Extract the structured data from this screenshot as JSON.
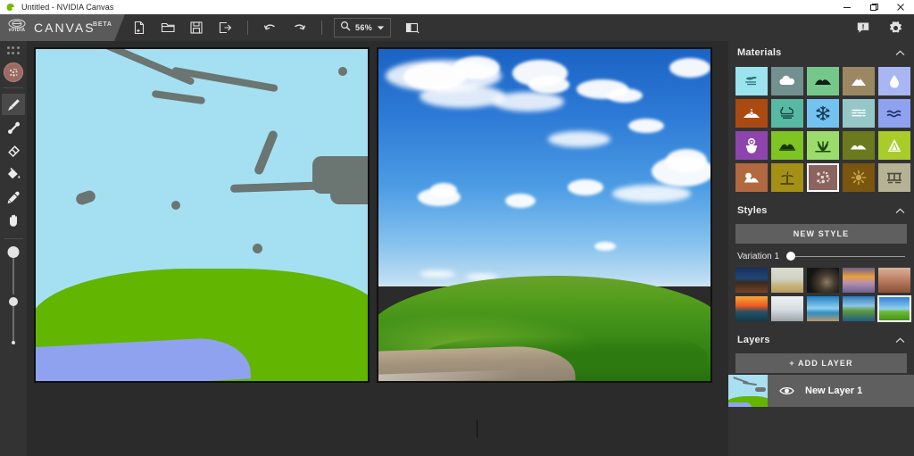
{
  "window": {
    "title": "Untitled - NVIDIA Canvas",
    "app_icon": "nvidia-app-icon",
    "minimize": "─",
    "maximize": "❐",
    "close": "✕"
  },
  "brand": {
    "logo": "nvidia-logo",
    "logo_wordmark": "nVIDIA",
    "name": "CANVAS",
    "beta": "BETA"
  },
  "toolbar": {
    "new_label": "new-document",
    "open_label": "open-project",
    "save_label": "save-project",
    "export_label": "export-image",
    "undo_label": "undo",
    "redo_label": "redo",
    "zoom_value": "56%",
    "zoom_icon": "magnifier-icon",
    "zoom_dropdown": "▼",
    "view_mode_label": "split-view-toggle",
    "feedback_label": "feedback-icon",
    "settings_label": "settings-gear-icon"
  },
  "tools": {
    "grip": "panel-drag-grip",
    "current_material_swatch_color": "#9c6a63",
    "items": [
      {
        "name": "paintbrush-tool",
        "label": "Paint Brush",
        "active": true
      },
      {
        "name": "line-tool",
        "label": "Line",
        "active": false
      },
      {
        "name": "eraser-tool",
        "label": "Eraser",
        "active": false
      },
      {
        "name": "fill-tool",
        "label": "Fill",
        "active": false
      },
      {
        "name": "eyedropper-tool",
        "label": "Eyedropper",
        "active": false
      },
      {
        "name": "hand-tool",
        "label": "Pan",
        "active": false
      }
    ],
    "brush_size_slider": {
      "name": "brush-size-slider",
      "knob_position_pct": 0
    },
    "brush_opacity_slider": {
      "name": "brush-opacity-slider",
      "knob_position_pct": 62
    }
  },
  "canvas": {
    "sketch_pane_name": "sketch-canvas",
    "render_pane_name": "rendered-output",
    "sketch": {
      "sky_color": "#a5e0f2",
      "grass_color": "#62b500",
      "water_color": "#8ea2f0",
      "stroke_color": "#6b7571"
    },
    "render": {
      "sky_top_color": "#1b63c4",
      "sky_bottom_color": "#cfe6f2",
      "grass_color": "#3f8f18",
      "water_color": "#a2937c",
      "cloud_color": "#ffffff"
    }
  },
  "materials": {
    "title": "Materials",
    "collapse_icon": "chevron-up-icon",
    "selected_index": 17,
    "items": [
      {
        "label": "Sky",
        "icon": "sky-icon",
        "bg": "#9be4ef",
        "fg": "#2f6f74"
      },
      {
        "label": "Cloud",
        "icon": "cloud-icon",
        "bg": "#71908f",
        "fg": "#ffffff"
      },
      {
        "label": "Hill",
        "icon": "hill-icon",
        "bg": "#74c98a",
        "fg": "#111d12"
      },
      {
        "label": "Mountain",
        "icon": "mountain-icon",
        "bg": "#9c8763",
        "fg": "#ffffff"
      },
      {
        "label": "Water",
        "icon": "waterdrop-icon",
        "bg": "#a8b7f4",
        "fg": "#ffffff"
      },
      {
        "label": "Mud",
        "icon": "mud-icon",
        "bg": "#ab4a10",
        "fg": "#ffffff"
      },
      {
        "label": "Fog",
        "icon": "fog-icon",
        "bg": "#57b8a4",
        "fg": "#123d36"
      },
      {
        "label": "Snow",
        "icon": "snowflake-icon",
        "bg": "#72c3f2",
        "fg": "#13344a"
      },
      {
        "label": "Sand",
        "icon": "sand-icon",
        "bg": "#95c7c9",
        "fg": "#ffffff"
      },
      {
        "label": "Sea",
        "icon": "sea-icon",
        "bg": "#8ea2f0",
        "fg": "#1c2c6b"
      },
      {
        "label": "Flowers",
        "icon": "flower-icon",
        "bg": "#8e44ad",
        "fg": "#ffffff"
      },
      {
        "label": "Bush",
        "icon": "bush-icon",
        "bg": "#7ec422",
        "fg": "#16330a"
      },
      {
        "label": "Grass",
        "icon": "grass-icon",
        "bg": "#9bdc6c",
        "fg": "#1b4709"
      },
      {
        "label": "Hill2",
        "icon": "hills-icon",
        "bg": "#6b7a1e",
        "fg": "#ffffff"
      },
      {
        "label": "Tree",
        "icon": "tree-icon",
        "bg": "#a9cc2a",
        "fg": "#ffffff"
      },
      {
        "label": "Rock",
        "icon": "rock-icon",
        "bg": "#b2693f",
        "fg": "#ffffff"
      },
      {
        "label": "Desert",
        "icon": "palm-icon",
        "bg": "#a59016",
        "fg": "#3a3208"
      },
      {
        "label": "Gravel",
        "icon": "gravel-icon",
        "bg": "#8b6460",
        "fg": "#e6d7d4"
      },
      {
        "label": "Dirt",
        "icon": "dirt-icon",
        "bg": "#7a5510",
        "fg": "#c8a64a"
      },
      {
        "label": "Ruins",
        "icon": "ruins-icon",
        "bg": "#b5b296",
        "fg": "#4a4736"
      }
    ]
  },
  "styles": {
    "title": "Styles",
    "collapse_icon": "chevron-up-icon",
    "new_style_label": "NEW STYLE",
    "variation_label": "Variation 1",
    "variation_value_pct": 0,
    "selected_index": 9,
    "items": [
      {
        "name": "style-thumb-1",
        "c1": "#1e3a66",
        "c2": "#0b1524",
        "c3": "#7a4124"
      },
      {
        "name": "style-thumb-2",
        "c1": "#cfd2c4",
        "c2": "#e3e1d2",
        "c3": "#bda96f"
      },
      {
        "name": "style-thumb-3",
        "c1": "#121212",
        "c2": "#2b2b2b",
        "c3": "#7e6d58"
      },
      {
        "name": "style-thumb-4",
        "c1": "#8a6fa3",
        "c2": "#e9a13b",
        "c3": "#6d5f8f"
      },
      {
        "name": "style-thumb-5",
        "c1": "#c2876c",
        "c2": "#7a4531",
        "c3": "#d8b39a"
      },
      {
        "name": "style-thumb-6",
        "c1": "#f05a20",
        "c2": "#f3b24a",
        "c3": "#0f3b4c"
      },
      {
        "name": "style-thumb-7",
        "c1": "#cfd6da",
        "c2": "#eef1f3",
        "c3": "#8f9aa0"
      },
      {
        "name": "style-thumb-8",
        "c1": "#1f7fc2",
        "c2": "#8fd0ef",
        "c3": "#b9996d"
      },
      {
        "name": "style-thumb-9",
        "c1": "#2e7bb8",
        "c2": "#5f9b3c",
        "c3": "#1f5d86"
      },
      {
        "name": "style-thumb-10",
        "c1": "#2a7ad1",
        "c2": "#8fd0f2",
        "c3": "#4fa321"
      }
    ]
  },
  "layers": {
    "title": "Layers",
    "collapse_icon": "chevron-up-icon",
    "add_layer_label": "+ ADD LAYER",
    "items": [
      {
        "name": "New Layer 1",
        "visible": true,
        "visibility_icon": "eye-icon"
      }
    ]
  }
}
